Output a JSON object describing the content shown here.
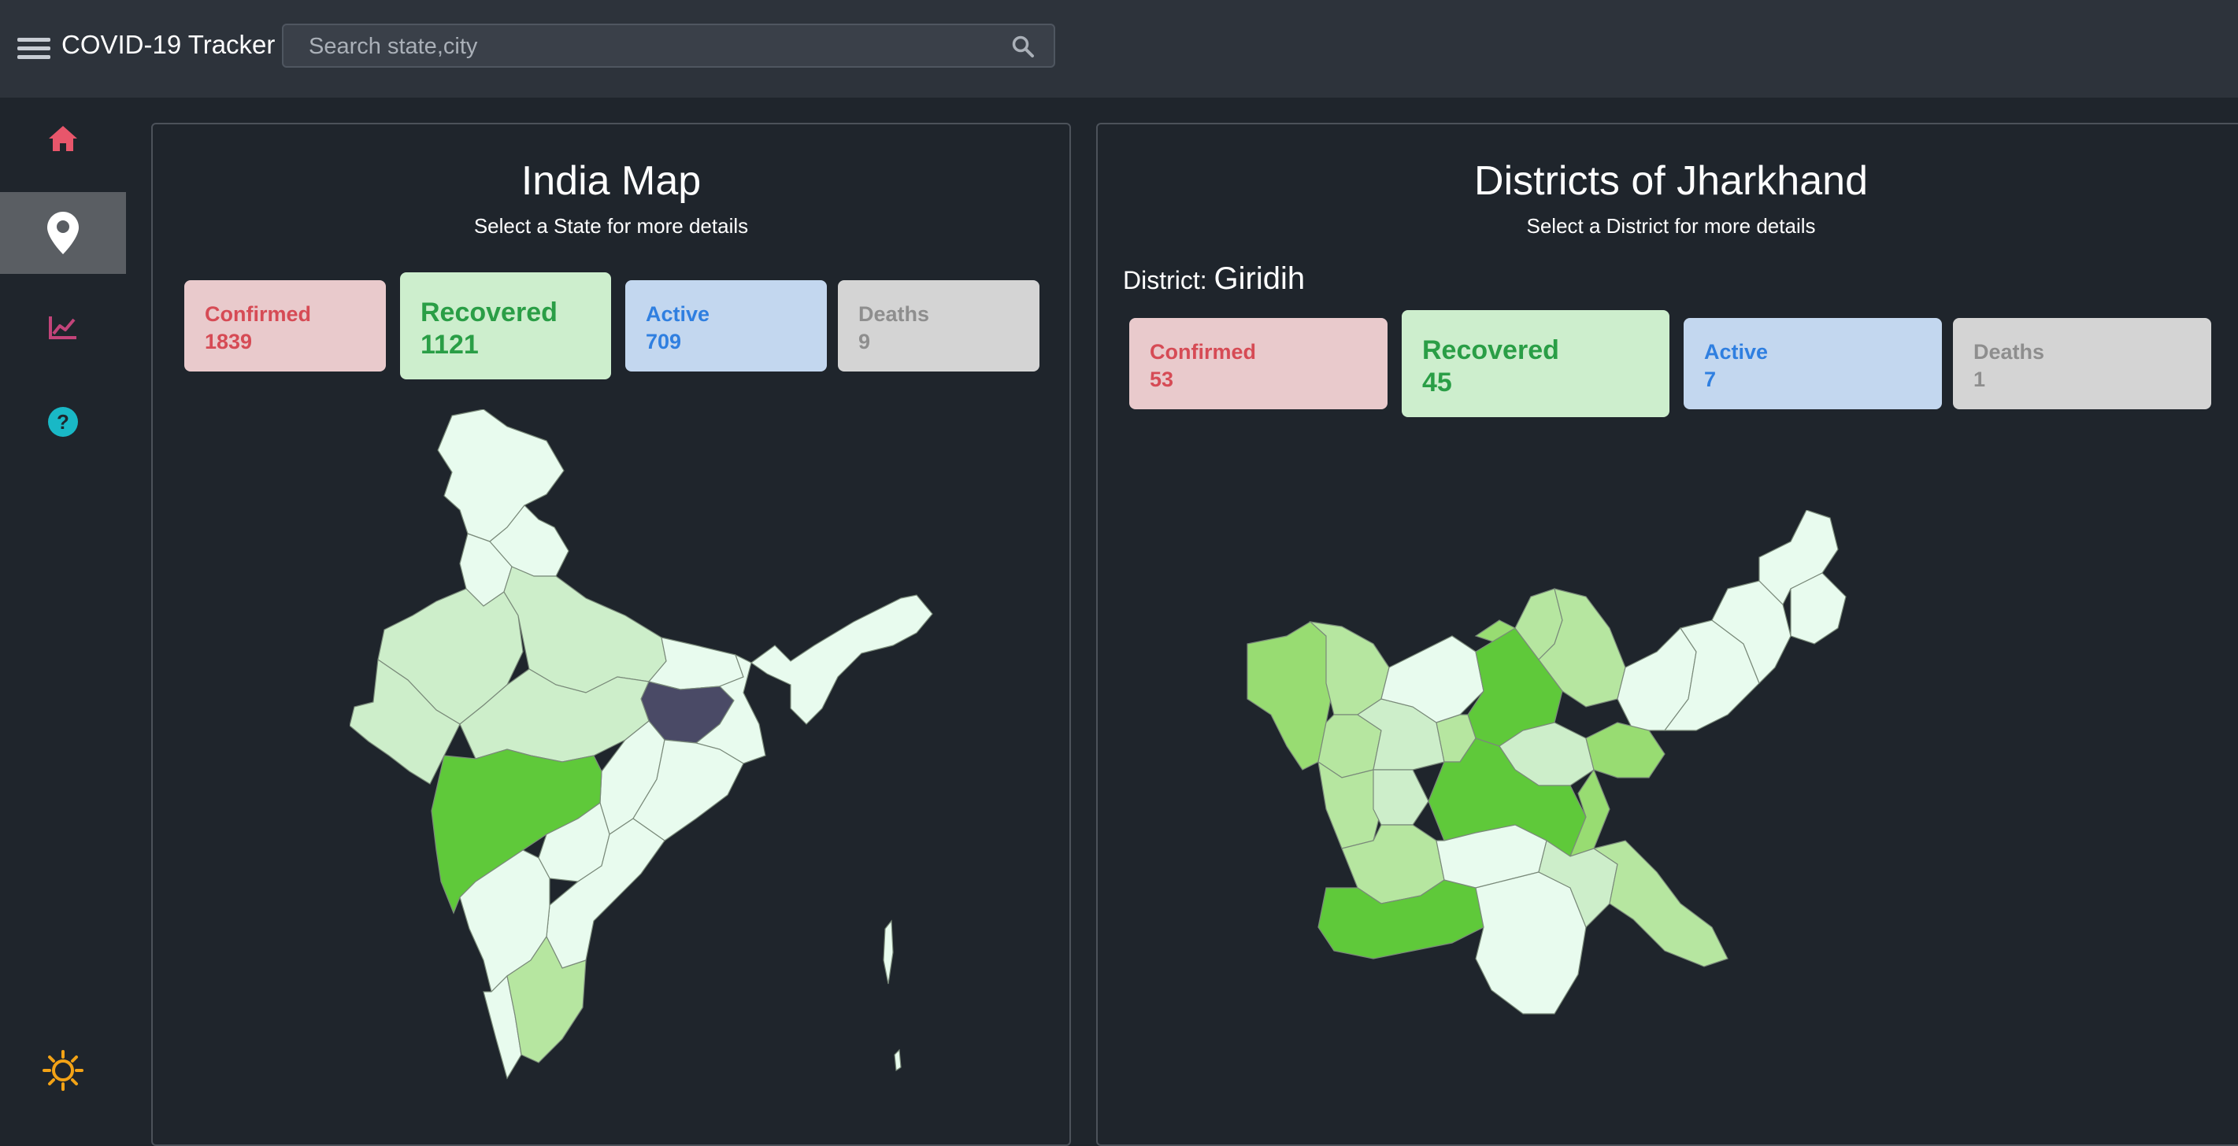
{
  "header": {
    "title": "COVID-19 Tracker",
    "search_placeholder": "Search state,city"
  },
  "sidebar": {
    "items": [
      {
        "icon": "home-icon",
        "color": "#e8566b"
      },
      {
        "icon": "map-pin-icon",
        "color": "#ffffff",
        "active": true
      },
      {
        "icon": "chart-line-icon",
        "color": "#c2447a"
      },
      {
        "icon": "help-icon",
        "color": "#19b8c6"
      }
    ],
    "bottom_icon": {
      "icon": "sun-icon",
      "color": "#f3a316"
    }
  },
  "india_panel": {
    "title": "India Map",
    "subtitle": "Select a State for more details",
    "stats": {
      "confirmed_label": "Confirmed",
      "confirmed": "1839",
      "recovered_label": "Recovered",
      "recovered": "1121",
      "active_label": "Active",
      "active": "709",
      "deaths_label": "Deaths",
      "deaths": "9"
    },
    "selected_state_color": "#4a4a66"
  },
  "district_panel": {
    "title": "Districts of Jharkhand",
    "subtitle": "Select a District for more details",
    "district_label": "District:",
    "district_name": "Giridih",
    "stats": {
      "confirmed_label": "Confirmed",
      "confirmed": "53",
      "recovered_label": "Recovered",
      "recovered": "45",
      "active_label": "Active",
      "active": "7",
      "deaths_label": "Deaths",
      "deaths": "1"
    }
  },
  "colors": {
    "map_palette": [
      "#e8fbee",
      "#cdeeca",
      "#b6e6a0",
      "#98dc72",
      "#5fc93a"
    ],
    "background": "#1f252c",
    "topbar": "#2d333b"
  }
}
